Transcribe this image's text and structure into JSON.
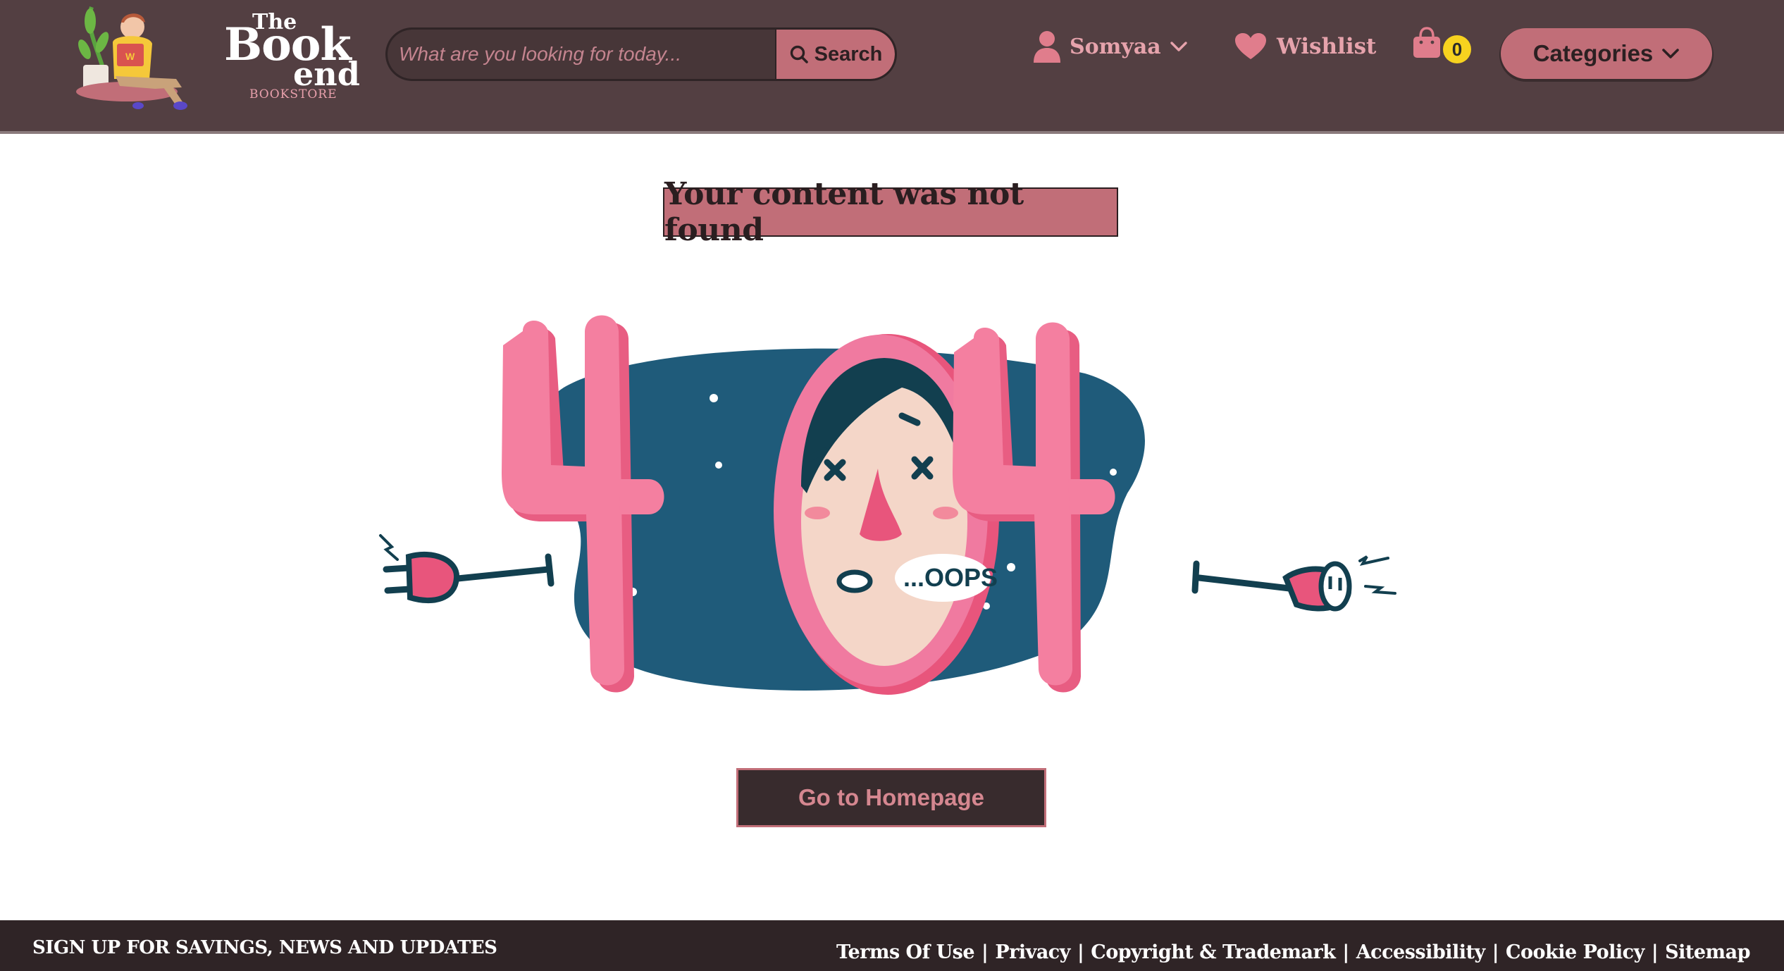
{
  "brand": {
    "logo_the": "The",
    "logo_book": "Book",
    "logo_end": "end",
    "logo_sub": "BOOKSTORE"
  },
  "search": {
    "placeholder": "What are you looking for today...",
    "value": "",
    "button_label": "Search"
  },
  "user_menu": {
    "name": "Somyaa"
  },
  "wishlist": {
    "label": "Wishlist"
  },
  "cart": {
    "count": "0"
  },
  "categories": {
    "label": "Categories"
  },
  "main": {
    "title": "Your content was not found",
    "illustration_text": "...OOPS",
    "home_button": "Go to Homepage"
  },
  "footer": {
    "signup": "SIGN UP FOR SAVINGS, NEWS AND UPDATES",
    "links": [
      "Terms Of Use",
      "Privacy",
      "Copyright & Trademark",
      "Accessibility",
      "Cookie Policy",
      "Sitemap"
    ]
  },
  "colors": {
    "header_bg": "#533f42",
    "accent_pink": "#c16e78",
    "footer_bg": "#2f2426",
    "badge_yellow": "#f7d21f"
  },
  "icons": [
    "search-icon",
    "user-icon",
    "chevron-down-icon",
    "heart-icon",
    "shopping-bag-icon"
  ]
}
